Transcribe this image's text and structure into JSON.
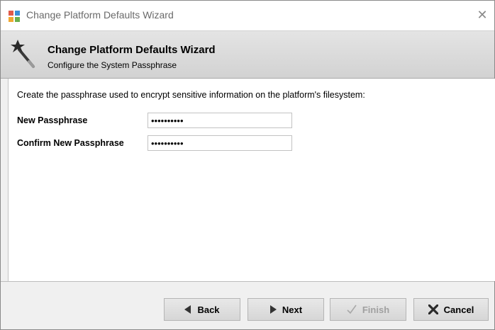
{
  "window": {
    "title": "Change Platform Defaults Wizard",
    "close_glyph": "✕"
  },
  "header": {
    "title": "Change Platform Defaults Wizard",
    "subtitle": "Configure the System Passphrase",
    "icon": "magic-wand-icon"
  },
  "content": {
    "intro": "Create the passphrase used to encrypt sensitive information on the platform's filesystem:",
    "fields": [
      {
        "label": "New Passphrase",
        "value": "••••••••••"
      },
      {
        "label": "Confirm New Passphrase",
        "value": "••••••••••"
      }
    ]
  },
  "buttons": {
    "back": {
      "label": "Back",
      "icon": "left-arrow-icon",
      "enabled": true
    },
    "next": {
      "label": "Next",
      "icon": "right-arrow-icon",
      "enabled": true
    },
    "finish": {
      "label": "Finish",
      "icon": "checkmark-icon",
      "enabled": false
    },
    "cancel": {
      "label": "Cancel",
      "icon": "x-icon",
      "enabled": true
    }
  },
  "colors": {
    "header_bg": "#d8d8d8",
    "content_bg": "#ffffff",
    "disabled_text": "#a0a0a0"
  }
}
